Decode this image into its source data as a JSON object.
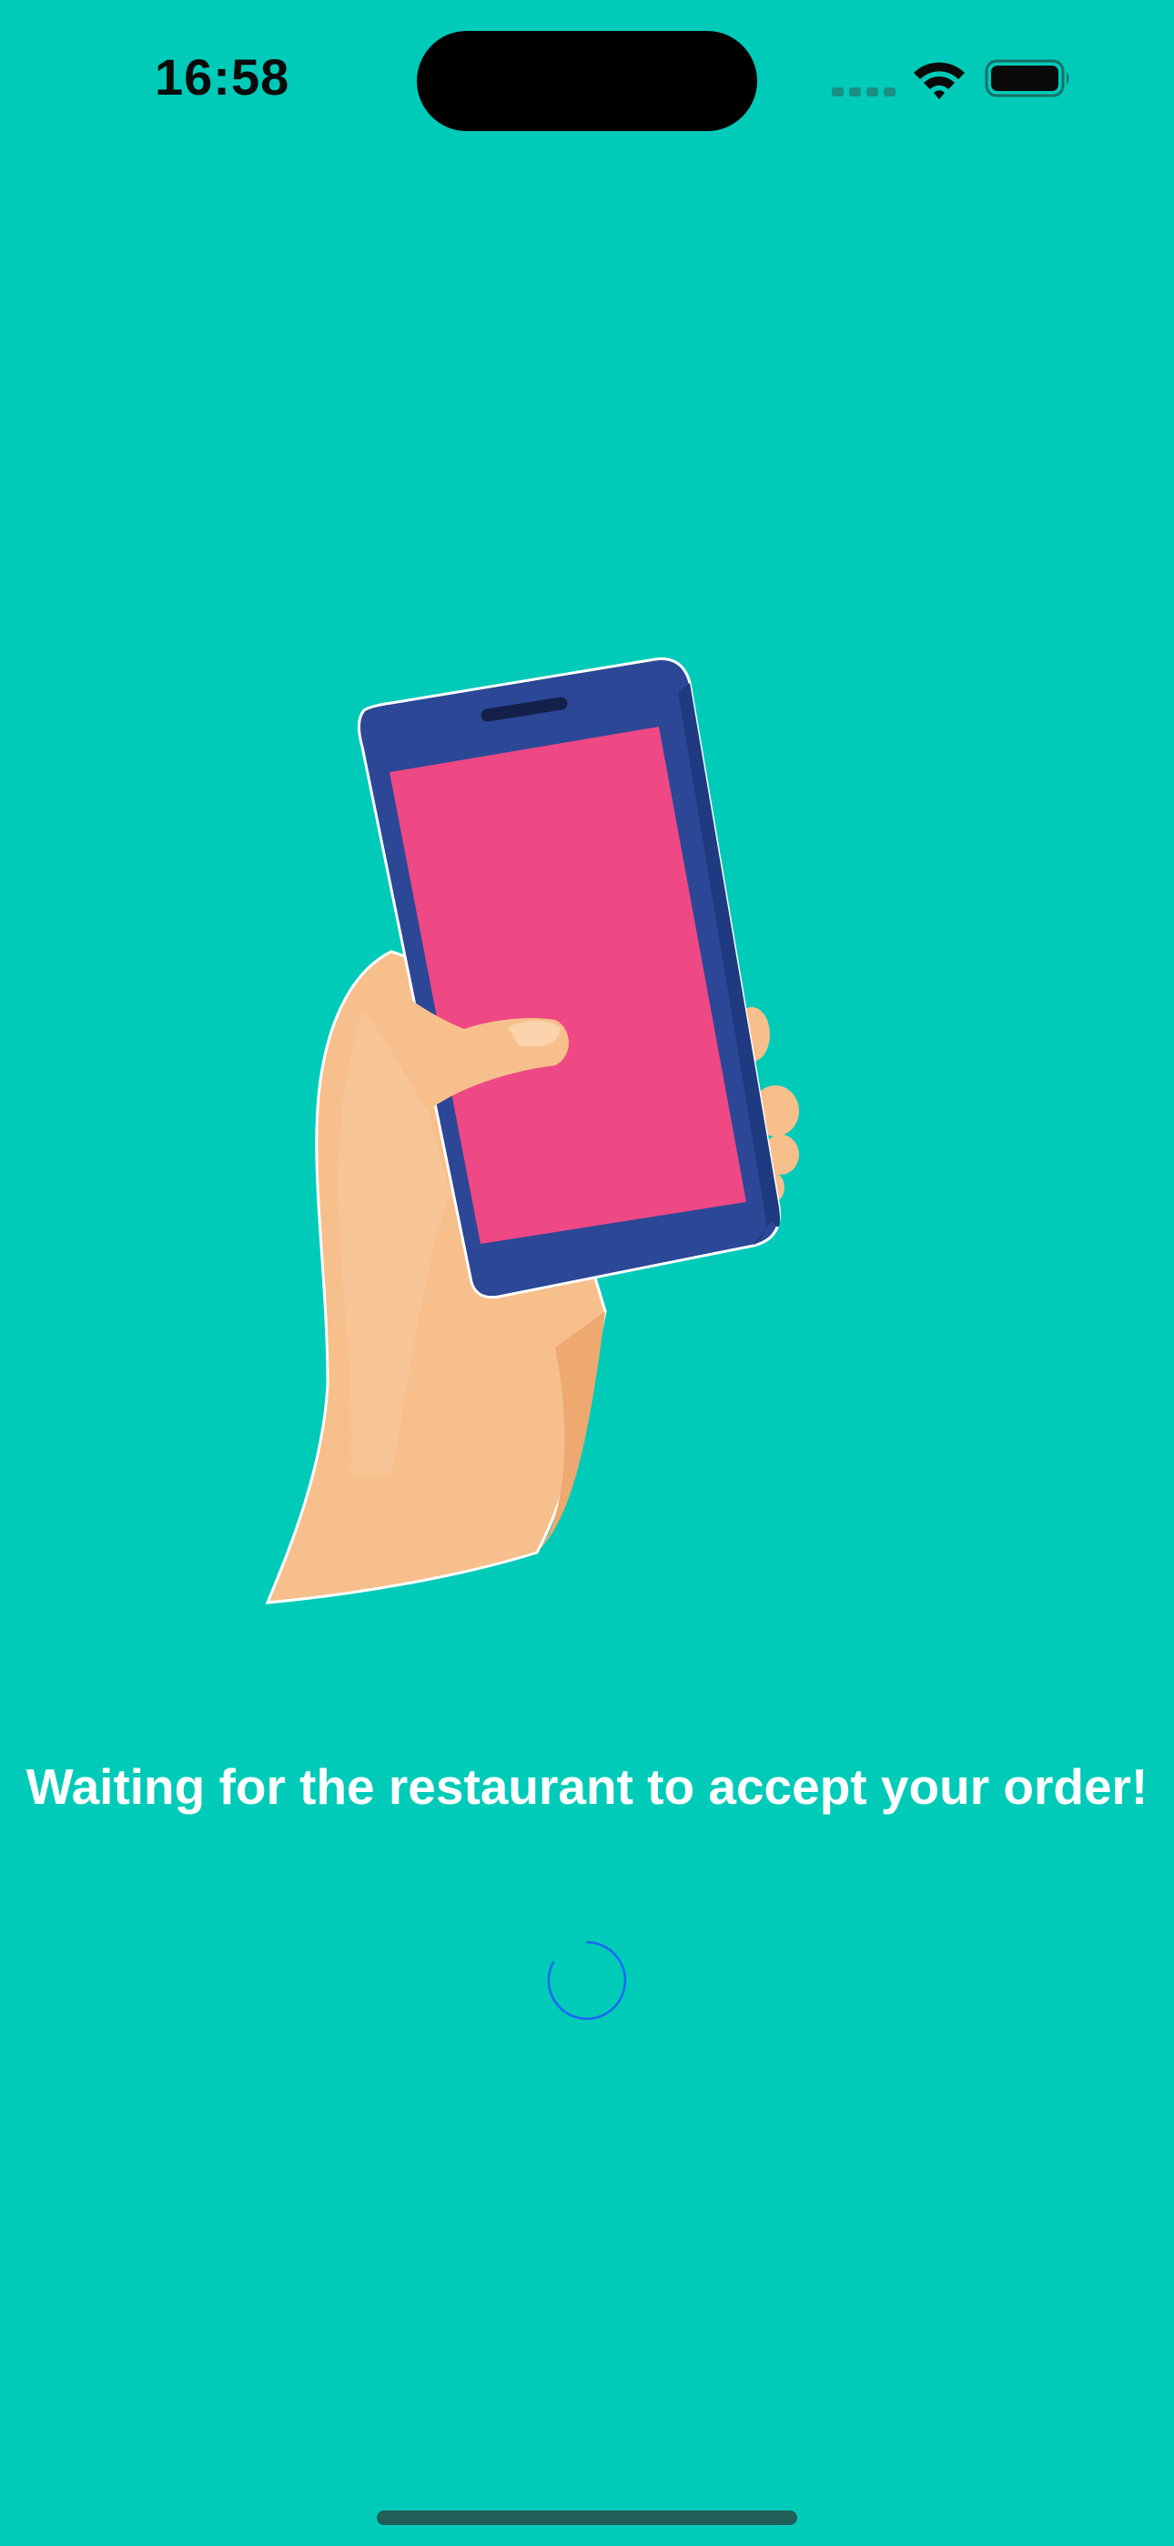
{
  "status_bar": {
    "time": "16:58",
    "signal_icon": "cellular-signal-icon",
    "wifi_icon": "wifi-icon",
    "battery_icon": "battery-icon"
  },
  "illustration": {
    "icon": "hand-holding-phone-illustration"
  },
  "message": "Waiting for the restaurant to accept your order!",
  "spinner": {
    "icon": "loading-spinner-icon",
    "color": "#1E66F5"
  },
  "colors": {
    "background": "#00CBB9",
    "text": "#FFFFFF",
    "phone_body": "#2B4796",
    "phone_screen": "#EE4885",
    "skin": "#F6BF8C"
  }
}
